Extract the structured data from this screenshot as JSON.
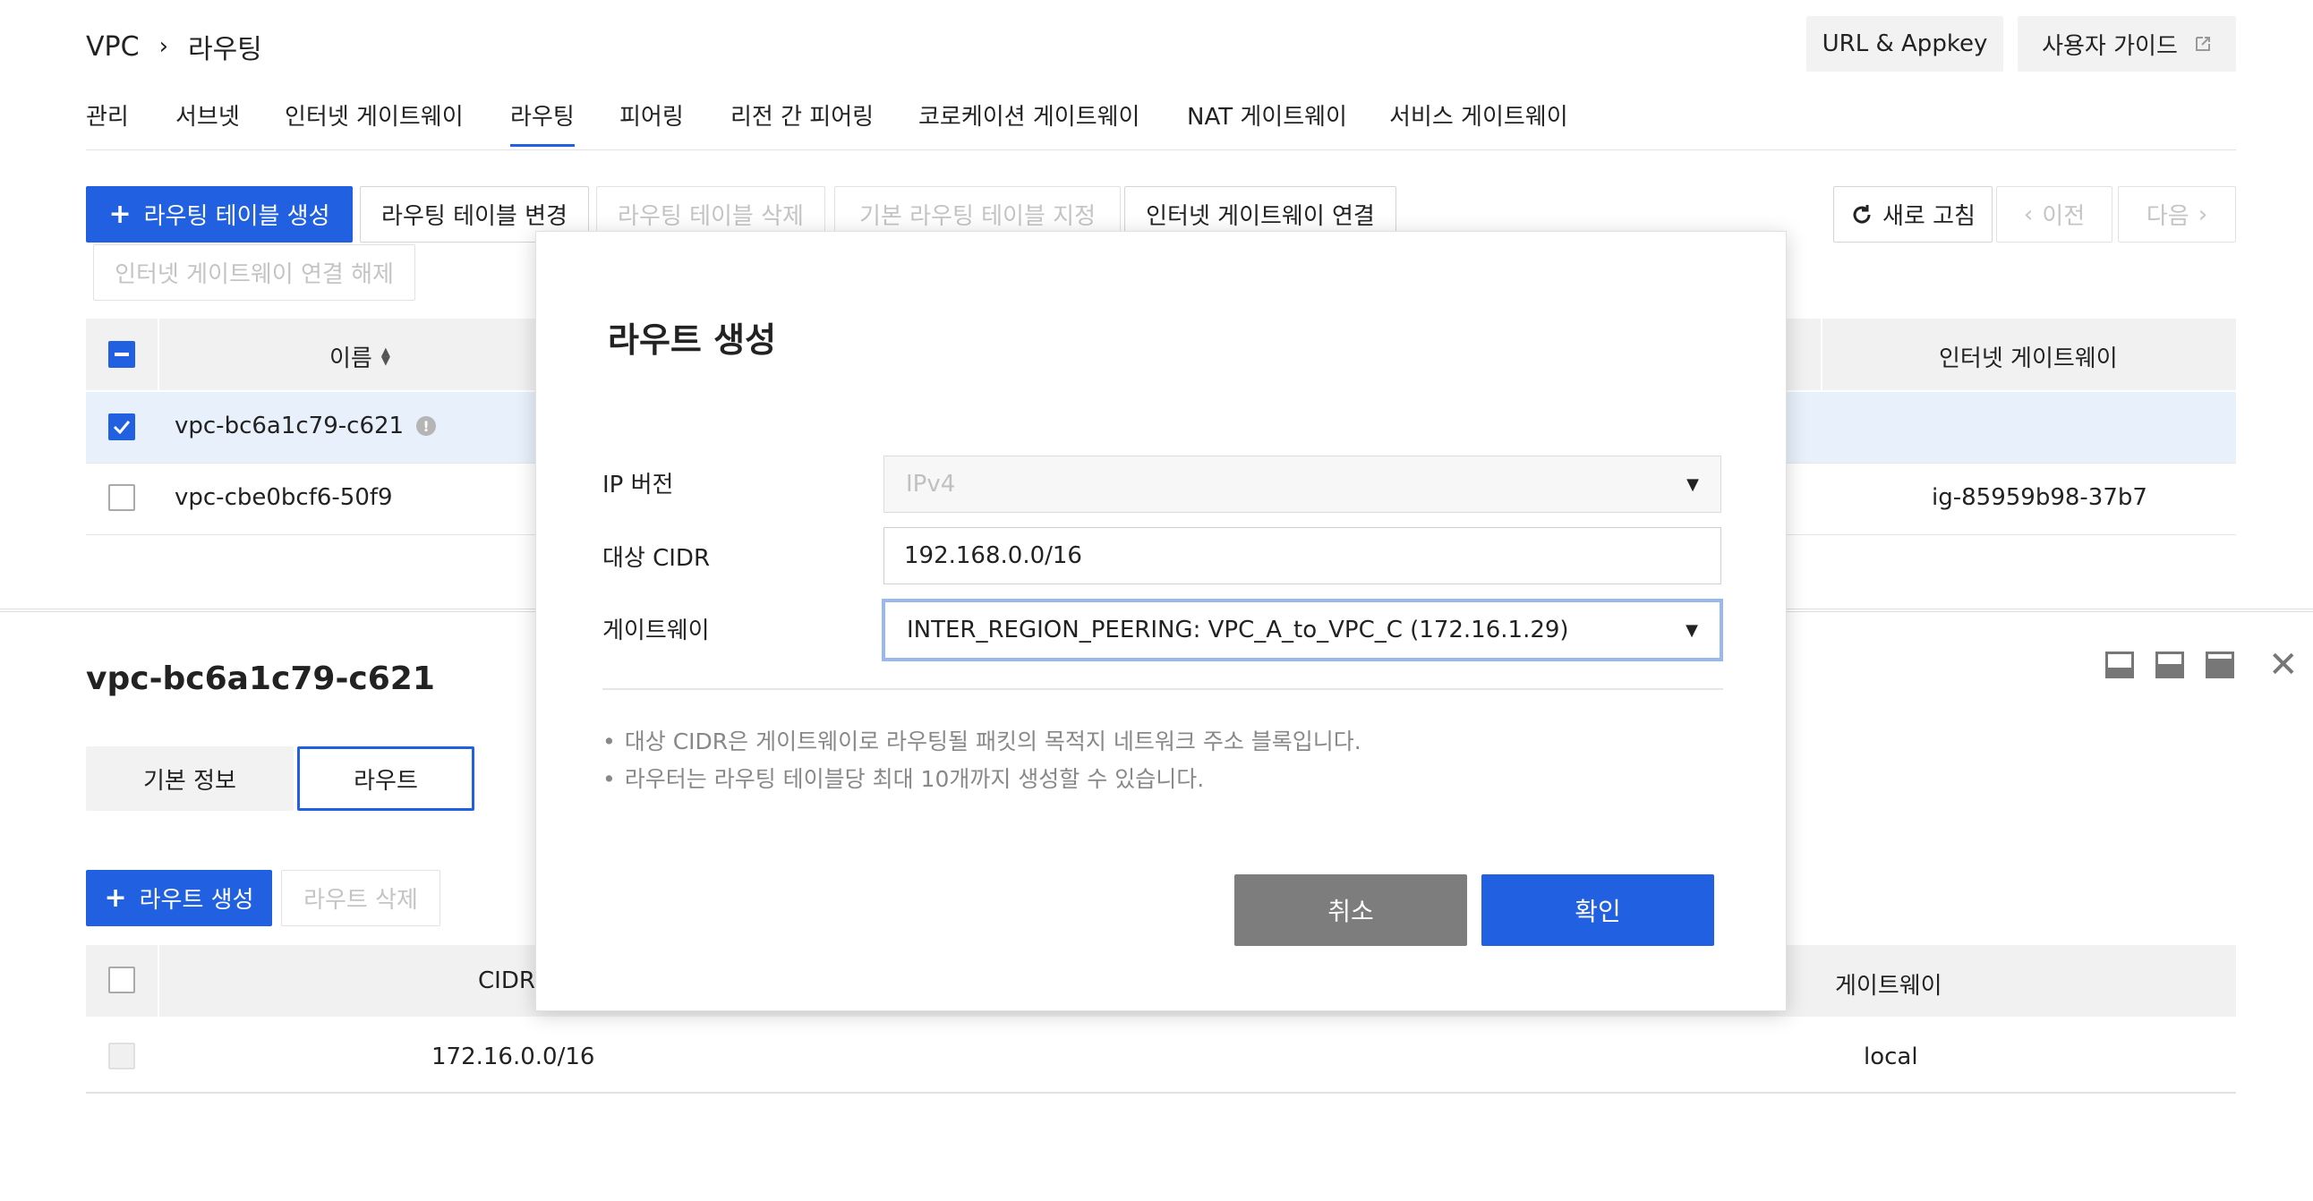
{
  "breadcrumb": {
    "root": "VPC",
    "current": "라우팅"
  },
  "header_buttons": {
    "url_appkey": "URL & Appkey",
    "user_guide": "사용자 가이드"
  },
  "tabs": [
    "관리",
    "서브넷",
    "인터넷 게이트웨이",
    "라우팅",
    "피어링",
    "리전 간 피어링",
    "코로케이션 게이트웨이",
    "NAT 게이트웨이",
    "서비스 게이트웨이"
  ],
  "active_tab": "라우팅",
  "toolbar": {
    "create": "라우팅 테이블 생성",
    "change": "라우팅 테이블 변경",
    "delete": "라우팅 테이블 삭제",
    "set_default": "기본 라우팅 테이블 지정",
    "connect_igw": "인터넷 게이트웨이 연결",
    "disconnect_igw": "인터넷 게이트웨이 연결 해제",
    "refresh": "새로 고침",
    "prev": "이전",
    "next": "다음"
  },
  "table": {
    "col_name": "이름",
    "col_igw": "인터넷 게이트웨이",
    "rows": [
      {
        "name": "vpc-bc6a1c79-c621",
        "igw": "",
        "checked": true
      },
      {
        "name": "vpc-cbe0bcf6-50f9",
        "igw": "ig-85959b98-37b7",
        "checked": false
      }
    ]
  },
  "detail": {
    "title": "vpc-bc6a1c79-c621",
    "tabs": [
      "기본 정보",
      "라우트"
    ],
    "active_tab": "라우트",
    "create_route": "라우트 생성",
    "delete_route": "라우트 삭제",
    "col_cidr": "CIDR",
    "col_gateway": "게이트웨이",
    "rows": [
      {
        "cidr": "172.16.0.0/16",
        "gateway": "local"
      }
    ]
  },
  "modal": {
    "title": "라우트 생성",
    "ip_version_label": "IP 버전",
    "ip_version_value": "IPv4",
    "cidr_label": "대상 CIDR",
    "cidr_value": "192.168.0.0/16",
    "gateway_label": "게이트웨이",
    "gateway_value": "INTER_REGION_PEERING: VPC_A_to_VPC_C (172.16.1.29)",
    "notes": [
      "대상 CIDR은 게이트웨이로 라우팅될 패킷의 목적지 네트워크 주소 블록입니다.",
      "라우터는 라우팅 테이블당 최대 10개까지 생성할 수 있습니다."
    ],
    "cancel": "취소",
    "confirm": "확인"
  },
  "colors": {
    "primary": "#2160e0",
    "cancel_button": "#7d7d7d",
    "selected_row": "#e8f0fb"
  }
}
